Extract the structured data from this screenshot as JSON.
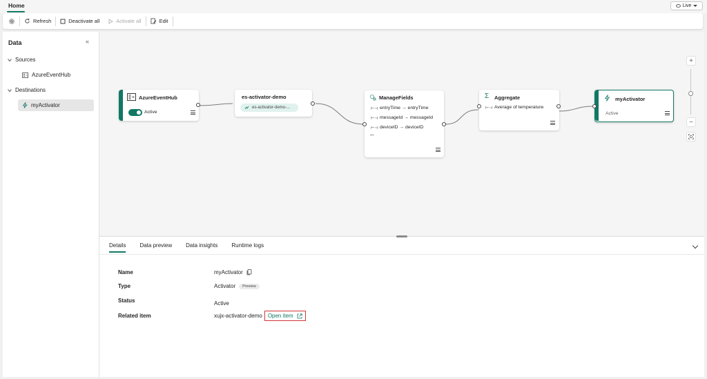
{
  "header": {
    "home_tab": "Home",
    "live_label": "Live"
  },
  "toolbar": {
    "refresh_label": "Refresh",
    "deactivate_all_label": "Deactivate all",
    "activate_all_label": "Activate all",
    "edit_label": "Edit"
  },
  "sidebar": {
    "title": "Data",
    "sources_label": "Sources",
    "source_item": "AzureEventHub",
    "destinations_label": "Destinations",
    "destination_item": "myActivator"
  },
  "canvas": {
    "nodes": {
      "eventhub": {
        "title": "AzureEventHub",
        "status": "Active"
      },
      "stream": {
        "title": "es-activator-demo",
        "pill": "es-activator-demo-..."
      },
      "managefields": {
        "title": "ManageFields",
        "fields": [
          "entryTime → entryTime",
          "messageId → messageId",
          "deviceID → deviceID"
        ],
        "more": "..."
      },
      "aggregate": {
        "title": "Aggregate",
        "detail": "Average of temperature"
      },
      "activator": {
        "title": "myActivator",
        "status": "Active"
      }
    },
    "zoom": {
      "zoom_in": "+",
      "zoom_out": "−"
    }
  },
  "details": {
    "tabs": [
      "Details",
      "Data preview",
      "Data insights",
      "Runtime logs"
    ],
    "active_tab": "Details",
    "rows": {
      "name_key": "Name",
      "name_value": "myActivator",
      "type_key": "Type",
      "type_value": "Activator",
      "type_badge": "Preview",
      "status_key": "Status",
      "status_value": "Active",
      "related_key": "Related item",
      "related_value": "xujx-activator-demo",
      "open_item": "Open item"
    }
  },
  "colors": {
    "accent": "#117865",
    "highlight_border": "#d13438"
  }
}
